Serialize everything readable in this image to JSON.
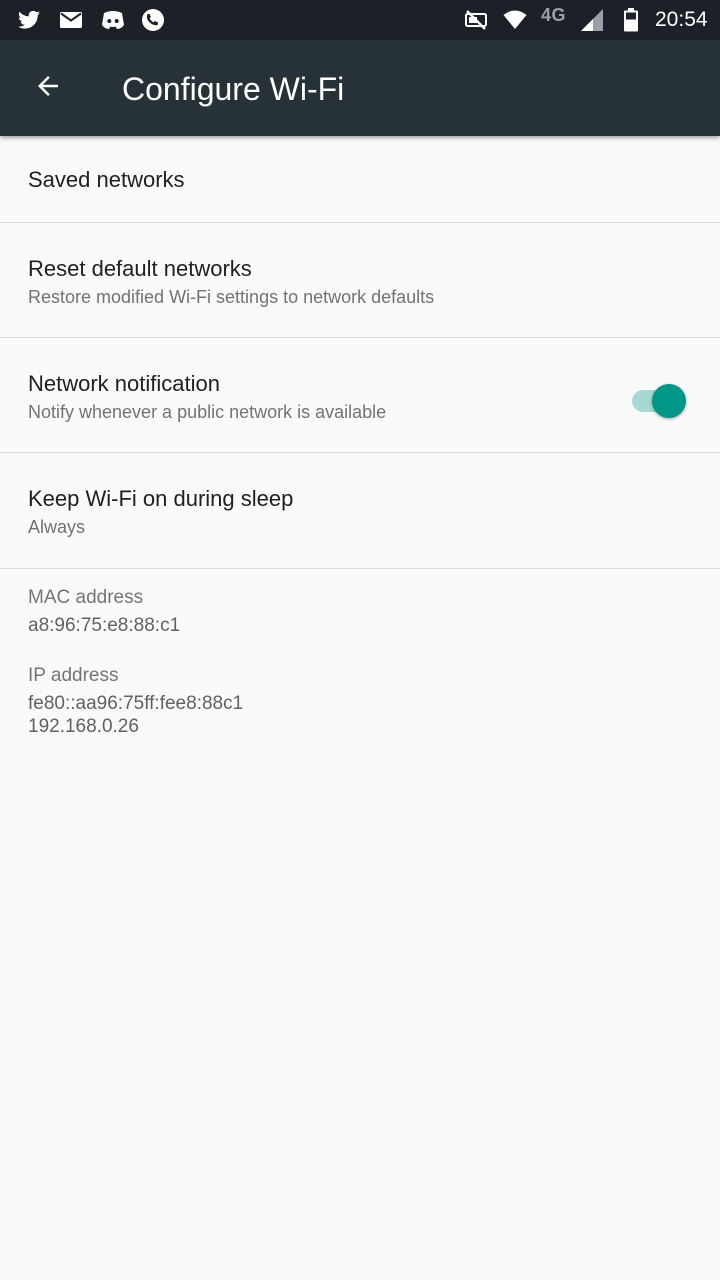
{
  "status_bar": {
    "left_icons": [
      "twitter-icon",
      "mail-icon",
      "discord-icon",
      "phone-call-icon"
    ],
    "right_icons": [
      "no-sim-icon",
      "wifi-icon",
      "cell-signal-icon",
      "battery-icon"
    ],
    "network_type": "4G",
    "time": "20:54"
  },
  "app_bar": {
    "title": "Configure Wi-Fi",
    "back_icon": "arrow-back-icon",
    "background": "#263238"
  },
  "preferences": [
    {
      "title": "Saved networks",
      "summary": ""
    },
    {
      "title": "Reset default networks",
      "summary": "Restore modified Wi-Fi settings to network defaults"
    },
    {
      "title": "Network notification",
      "summary": "Notify whenever a public network is available",
      "toggle_on": true
    },
    {
      "title": "Keep Wi-Fi on during sleep",
      "summary": "Always"
    }
  ],
  "info": {
    "mac_label": "MAC address",
    "mac_value": "a8:96:75:e8:88:c1",
    "ip_label": "IP address",
    "ip_v6": "fe80::aa96:75ff:fee8:88c1",
    "ip_v4": "192.168.0.26"
  },
  "colors": {
    "accent": "#009688",
    "accent_track": "#a8d8d2",
    "status_bar": "#1b2126",
    "background": "#fafafa"
  }
}
